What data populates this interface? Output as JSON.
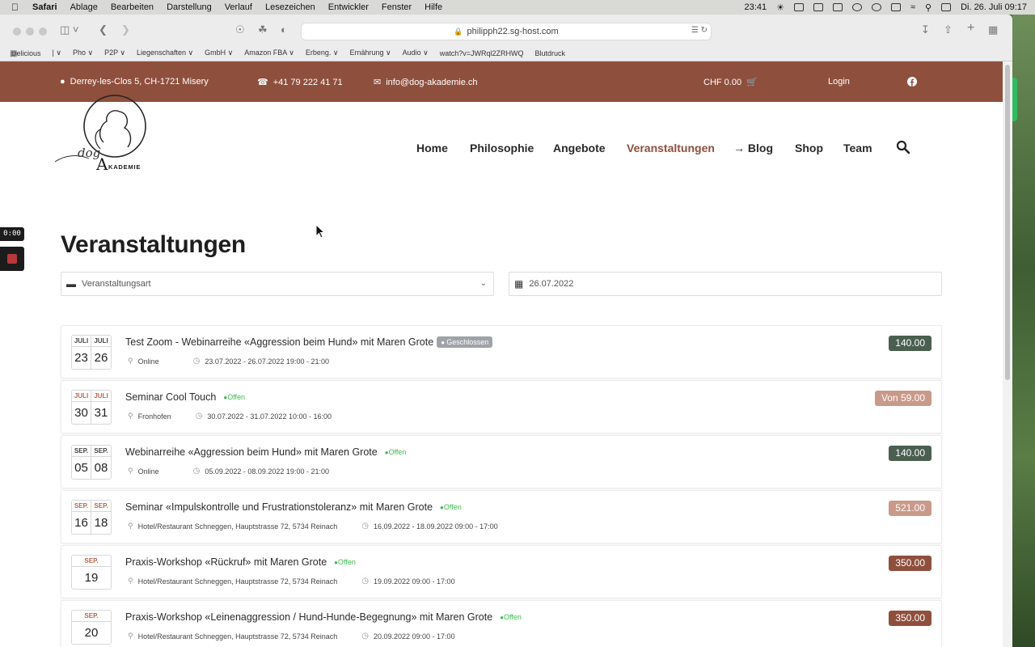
{
  "menubar": {
    "app": "Safari",
    "items": [
      "Ablage",
      "Bearbeiten",
      "Darstellung",
      "Verlauf",
      "Lesezeichen",
      "Entwickler",
      "Fenster",
      "Hilfe"
    ],
    "time": "23:41",
    "date": "Di. 26. Juli  09:17"
  },
  "browser": {
    "url": "philipph22.sg-host.com",
    "bookmarks": [
      "Delicious",
      "| ∨",
      "Pho ∨",
      "P2P ∨",
      "Liegenschaften ∨",
      "GmbH ∨",
      "Amazon FBA ∨",
      "Erbeng. ∨",
      "Ernährung ∨",
      "Audio ∨",
      "watch?v=JWRql2ZRHWQ",
      "Blutdruck"
    ]
  },
  "topbar": {
    "address": "Derrey-les-Clos 5, CH-1721 Misery",
    "phone": "+41 79 222 41 71",
    "email": "info@dog-akademie.ch",
    "cart": "CHF 0.00",
    "login": "Login"
  },
  "logo": {
    "dog": "dog",
    "a": "A",
    "rest": "KADEMIE"
  },
  "nav": {
    "home": "Home",
    "philosophie": "Philosophie",
    "angebote": "Angebote",
    "veranstaltungen": "Veranstaltungen",
    "blog": "→ Blog",
    "shop": "Shop",
    "team": "Team"
  },
  "page": {
    "title": "Veranstaltungen",
    "filter_type_placeholder": "Veranstaltungsart",
    "filter_date": "26.07.2022"
  },
  "colors": {
    "brand": "#8f4f3d",
    "price_dark_green": "#4a5f4f",
    "price_pink": "#c9998a",
    "price_brown": "#8f4f3d",
    "open_green": "#3fb950"
  },
  "events": [
    {
      "m1": "JULI",
      "d1": "23",
      "m2": "JULI",
      "d2": "26",
      "title": "Test Zoom - Webinarreihe «Aggression beim Hund» mit Maren Grote",
      "status": "Geschlossen",
      "location": "Online",
      "datetime": "23.07.2022 - 26.07.2022 19:00 - 21:00",
      "price": "140.00"
    },
    {
      "m1": "JULI",
      "d1": "30",
      "m2": "JULI",
      "d2": "31",
      "title": "Seminar Cool Touch",
      "status": "Offen",
      "location": "Fronhofen",
      "datetime": "30.07.2022 - 31.07.2022 10:00 - 16:00",
      "price": "Von 59.00"
    },
    {
      "m1": "SEP.",
      "d1": "05",
      "m2": "SEP.",
      "d2": "08",
      "title": "Webinarreihe «Aggression beim Hund» mit Maren Grote",
      "status": "Offen",
      "location": "Online",
      "datetime": "05.09.2022 - 08.09.2022 19:00 - 21:00",
      "price": "140.00"
    },
    {
      "m1": "SEP.",
      "d1": "16",
      "m2": "SEP.",
      "d2": "18",
      "title": "Seminar «Impulskontrolle und Frustrationstoleranz» mit Maren Grote",
      "status": "Offen",
      "location": "Hotel/Restaurant Schneggen, Hauptstrasse 72, 5734 Reinach",
      "datetime": "16.09.2022 - 18.09.2022 09:00 - 17:00",
      "price": "521.00"
    },
    {
      "m1": "SEP.",
      "d1": "19",
      "title": "Praxis-Workshop «Rückruf» mit Maren Grote",
      "status": "Offen",
      "location": "Hotel/Restaurant Schneggen, Hauptstrasse 72, 5734 Reinach",
      "datetime": "19.09.2022 09:00 - 17:00",
      "price": "350.00"
    },
    {
      "m1": "SEP.",
      "d1": "20",
      "title": "Praxis-Workshop «Leinenaggression / Hund-Hunde-Begegnung» mit Maren Grote",
      "status": "Offen",
      "location": "Hotel/Restaurant Schneggen, Hauptstrasse 72, 5734 Reinach",
      "datetime": "20.09.2022 09:00 - 17:00",
      "price": "350.00"
    }
  ],
  "recorder": {
    "time": "0:00"
  }
}
